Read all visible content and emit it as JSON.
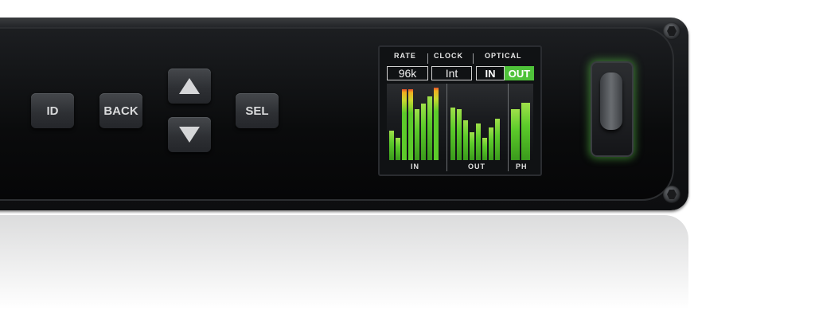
{
  "buttons": {
    "id_label": "ID",
    "back_label": "BACK",
    "sel_label": "SEL"
  },
  "display": {
    "headers": {
      "rate": "RATE",
      "clock": "CLOCK",
      "optical": "OPTICAL"
    },
    "values": {
      "rate": "96k",
      "clock": "Int",
      "optical_in": "IN",
      "optical_out": "OUT"
    },
    "meter_labels": {
      "in": "IN",
      "out": "OUT",
      "ph": "PH"
    },
    "meters": {
      "in": [
        0.4,
        0.3,
        0.97,
        0.97,
        0.7,
        0.77,
        0.87,
        0.99
      ],
      "out": [
        0.72,
        0.7,
        0.54,
        0.38,
        0.5,
        0.3,
        0.45,
        0.56
      ],
      "ph": [
        0.7,
        0.78
      ]
    },
    "colors": {
      "meter_green": "#5ccb2a",
      "peak": "#f0b020",
      "optical_active": "#4fc23a"
    }
  }
}
